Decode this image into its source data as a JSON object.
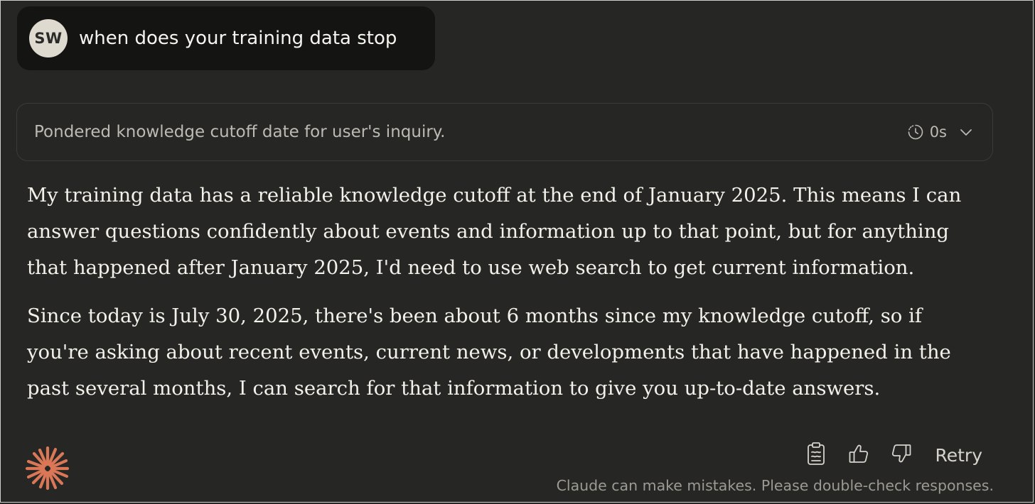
{
  "user_message": {
    "avatar_initials": "SW",
    "text": "when does your training data stop"
  },
  "thinking": {
    "summary": "Pondered knowledge cutoff date for user's inquiry.",
    "duration": "0s",
    "icons": [
      "clock-icon",
      "chevron-down-icon"
    ]
  },
  "response": {
    "paragraphs": [
      "My training data has a reliable knowledge cutoff at the end of January 2025. This means I can answer questions confidently about events and information up to that point, but for anything that happened after January 2025, I'd need to use web search to get current information.",
      "Since today is July 30, 2025, there's been about 6 months since my knowledge cutoff, so if you're asking about recent events, current news, or developments that have happened in the past several months, I can search for that information to give you up-to-date answers."
    ]
  },
  "actions": {
    "icons": [
      "copy-icon",
      "thumbs-up-icon",
      "thumbs-down-icon"
    ],
    "retry_label": "Retry"
  },
  "disclaimer": "Claude can make mistakes. Please double-check responses.",
  "colors": {
    "background": "#262624",
    "user_bubble": "#141413",
    "avatar": "#dedad0",
    "claude_accent": "#d97757",
    "text": "#f3f1ea",
    "muted_text": "#9c9a93"
  }
}
